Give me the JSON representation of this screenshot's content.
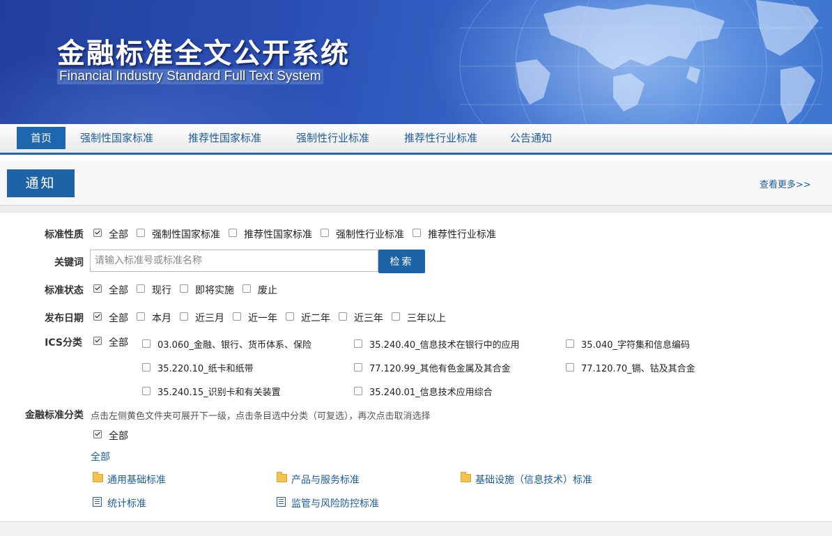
{
  "banner": {
    "title_cn": "金融标准全文公开系统",
    "title_en": "Financial Industry Standard Full Text System"
  },
  "nav": {
    "items": [
      {
        "label": "首页",
        "active": true
      },
      {
        "label": "强制性国家标准",
        "active": false
      },
      {
        "label": "推荐性国家标准",
        "active": false
      },
      {
        "label": "强制性行业标准",
        "active": false
      },
      {
        "label": "推荐性行业标准",
        "active": false
      },
      {
        "label": "公告通知",
        "active": false
      }
    ]
  },
  "notice": {
    "title": "通知",
    "more": "查看更多>>"
  },
  "filters": {
    "nature": {
      "label": "标准性质",
      "options": [
        {
          "label": "全部",
          "checked": true
        },
        {
          "label": "强制性国家标准",
          "checked": false
        },
        {
          "label": "推荐性国家标准",
          "checked": false
        },
        {
          "label": "强制性行业标准",
          "checked": false
        },
        {
          "label": "推荐性行业标准",
          "checked": false
        }
      ]
    },
    "keyword": {
      "label": "关键词",
      "placeholder": "请输入标准号或标准名称",
      "value": "",
      "button": "检索"
    },
    "status": {
      "label": "标准状态",
      "options": [
        {
          "label": "全部",
          "checked": true
        },
        {
          "label": "现行",
          "checked": false
        },
        {
          "label": "即将实施",
          "checked": false
        },
        {
          "label": "废止",
          "checked": false
        }
      ]
    },
    "date": {
      "label": "发布日期",
      "options": [
        {
          "label": "全部",
          "checked": true
        },
        {
          "label": "本月",
          "checked": false
        },
        {
          "label": "近三月",
          "checked": false
        },
        {
          "label": "近一年",
          "checked": false
        },
        {
          "label": "近二年",
          "checked": false
        },
        {
          "label": "近三年",
          "checked": false
        },
        {
          "label": "三年以上",
          "checked": false
        }
      ]
    },
    "ics": {
      "label": "ICS分类",
      "all": {
        "label": "全部",
        "checked": true
      },
      "options": [
        {
          "label": "03.060_金融、银行、货币体系、保险",
          "checked": false
        },
        {
          "label": "35.240.40_信息技术在银行中的应用",
          "checked": false
        },
        {
          "label": "35.040_字符集和信息编码",
          "checked": false
        },
        {
          "label": "35.220.10_纸卡和纸带",
          "checked": false
        },
        {
          "label": "77.120.99_其他有色金属及其合金",
          "checked": false
        },
        {
          "label": "77.120.70_镉、钴及其合金",
          "checked": false
        },
        {
          "label": "35.240.15_识别卡和有关装置",
          "checked": false
        },
        {
          "label": "35.240.01_信息技术应用综合",
          "checked": false
        }
      ]
    },
    "finance": {
      "label": "金融标准分类",
      "hint": "点击左侧黄色文件夹可展开下一级，点击条目选中分类（可复选），再次点击取消选择",
      "all_checkbox": {
        "label": "全部",
        "checked": true
      },
      "all_link": "全部",
      "categories": [
        {
          "label": "通用基础标准",
          "icon": "folder-icon"
        },
        {
          "label": "产品与服务标准",
          "icon": "folder-icon"
        },
        {
          "label": "基础设施（信息技术）标准",
          "icon": "folder-icon"
        },
        {
          "label": "统计标准",
          "icon": "doc-icon"
        },
        {
          "label": "监管与风险防控标准",
          "icon": "doc-icon"
        }
      ]
    }
  },
  "colors": {
    "primary": "#1e63a8",
    "link": "#1d5c9c",
    "banner_dark": "#223f9c"
  }
}
